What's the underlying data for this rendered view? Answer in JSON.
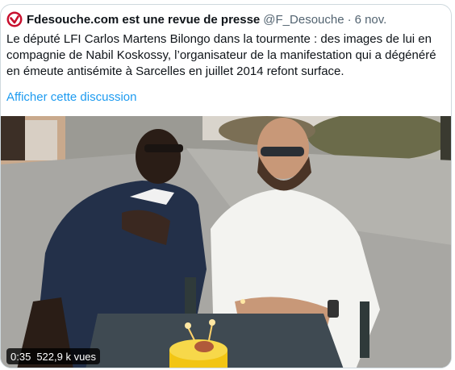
{
  "tweet": {
    "author_name": "Fdesouche.com est une revue de presse",
    "handle": "@F_Desouche",
    "separator": "·",
    "date": "6 nov.",
    "text_line1": "Le député LFI Carlos Martens Bilongo dans la tourmente : des images de lui en",
    "text_line2": "compagnie de  Nabil Koskossy, l’organisateur de la manifestation qui a dégénéré",
    "text_line3": "en émeute antisémite à Sarcelles en juillet 2014 refont surface.",
    "show_thread": "Afficher cette discussion"
  },
  "video": {
    "duration": "0:35",
    "views": "522,9 k vues"
  },
  "colors": {
    "link": "#1d9bf0",
    "avatar_red": "#c8102e",
    "text": "#0f1419",
    "muted": "#536471",
    "border": "#cfd9de"
  },
  "icons": {
    "avatar": "red-circle-check-logo"
  }
}
